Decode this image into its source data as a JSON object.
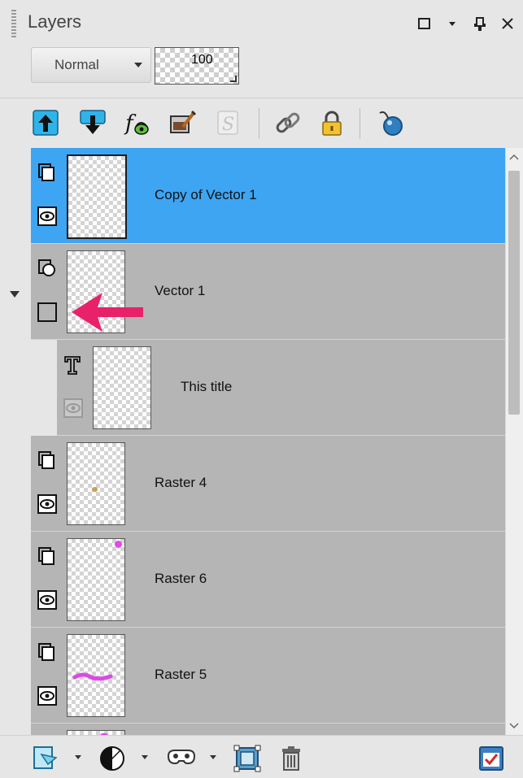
{
  "panel": {
    "title": "Layers",
    "blend_mode": "Normal",
    "opacity": "100"
  },
  "layers": [
    {
      "name": "Copy of Vector 1",
      "selected": true
    },
    {
      "name": "Vector 1"
    },
    {
      "name": "This title"
    },
    {
      "name": "Raster 4"
    },
    {
      "name": "Raster 6"
    },
    {
      "name": "Raster 5"
    }
  ],
  "colors": {
    "selected": "#3ea5f3",
    "row": "#b5b5b5",
    "arrow": "#e8216a"
  }
}
